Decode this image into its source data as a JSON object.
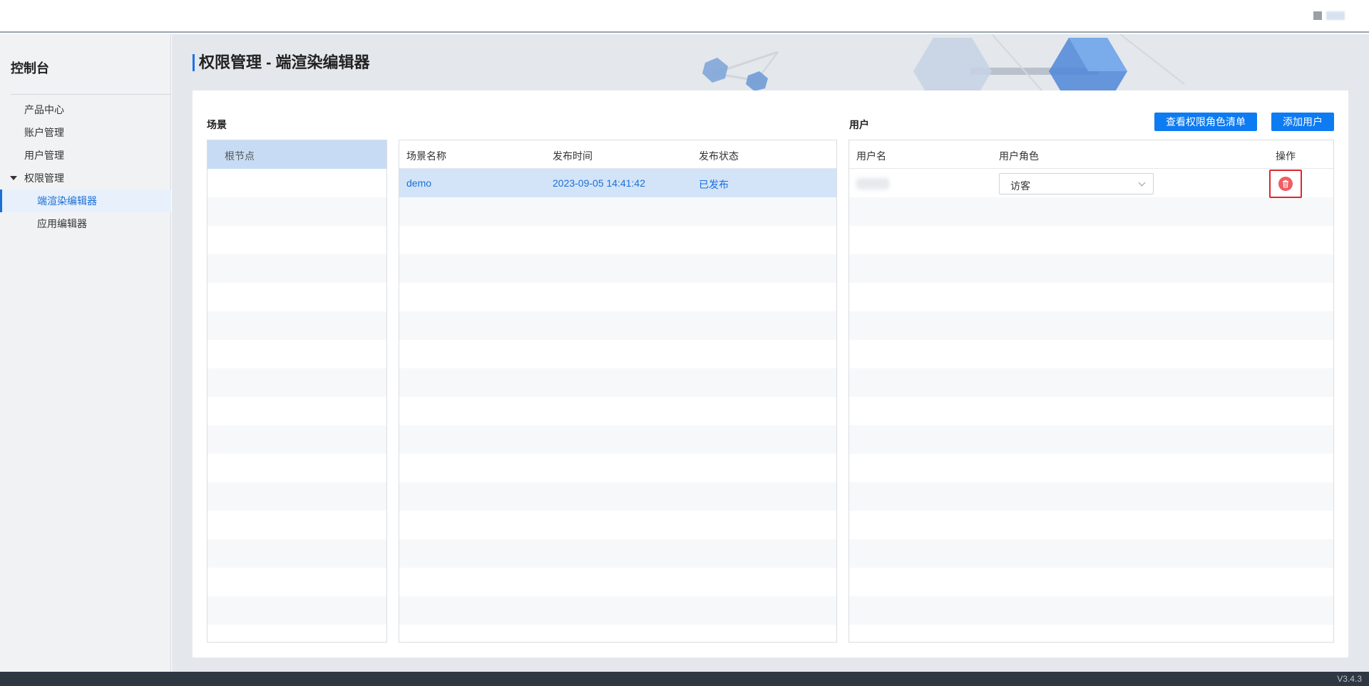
{
  "sidebar": {
    "title": "控制台",
    "items": [
      {
        "label": "产品中心"
      },
      {
        "label": "账户管理"
      },
      {
        "label": "用户管理"
      },
      {
        "label": "权限管理"
      },
      {
        "label": "端渲染编辑器"
      },
      {
        "label": "应用编辑器"
      }
    ]
  },
  "page": {
    "title": "权限管理 - 端渲染编辑器"
  },
  "scene": {
    "label": "场景",
    "tree_root": "根节点",
    "columns": [
      "场景名称",
      "发布时间",
      "发布状态"
    ],
    "rows": [
      {
        "name": "demo",
        "time": "2023-09-05 14:41:42",
        "status": "已发布"
      }
    ]
  },
  "users": {
    "label": "用户",
    "view_roles_button": "查看权限角色清单",
    "add_user_button": "添加用户",
    "columns": [
      "用户名",
      "用户角色",
      "操作"
    ],
    "rows": [
      {
        "role": "访客"
      }
    ]
  },
  "footer": {
    "version": "V3.4.3"
  },
  "colors": {
    "accent": "#0d7bf2",
    "danger": "#ef5d62",
    "selected_row": "#d3e4f8"
  }
}
